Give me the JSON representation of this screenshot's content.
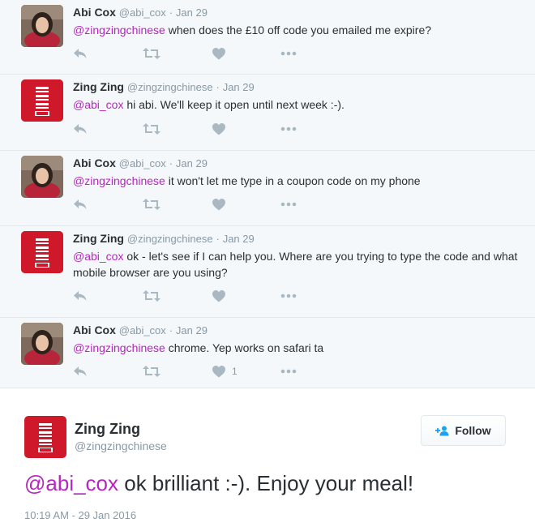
{
  "thread": [
    {
      "fullname": "Abi Cox",
      "handle": "@abi_cox",
      "time": "Jan 29",
      "mention": "@zingzingchinese",
      "text": " when does the £10 off code you emailed me expire?",
      "avatar": "abi-avatar",
      "likes": ""
    },
    {
      "fullname": "Zing Zing",
      "handle": "@zingzingchinese",
      "time": "Jan 29",
      "mention": "@abi_cox",
      "text": " hi abi. We'll keep it open until next week :-).",
      "avatar": "zing-avatar",
      "likes": ""
    },
    {
      "fullname": "Abi Cox",
      "handle": "@abi_cox",
      "time": "Jan 29",
      "mention": "@zingzingchinese",
      "text": " it won't let me type in a coupon code on my phone",
      "avatar": "abi-avatar",
      "likes": ""
    },
    {
      "fullname": "Zing Zing",
      "handle": "@zingzingchinese",
      "time": "Jan 29",
      "mention": "@abi_cox",
      "text": " ok - let's see if I can help you. Where are you trying to type the code and what mobile browser are you using?",
      "avatar": "zing-avatar",
      "likes": ""
    },
    {
      "fullname": "Abi Cox",
      "handle": "@abi_cox",
      "time": "Jan 29",
      "mention": "@zingzingchinese",
      "text": " chrome. Yep works on safari ta",
      "avatar": "abi-avatar",
      "likes": "1"
    }
  ],
  "header_separator": "·",
  "focus": {
    "fullname": "Zing Zing",
    "handle": "@zingzingchinese",
    "follow_label": "Follow",
    "mention": "@abi_cox",
    "text": " ok brilliant :-). Enjoy your meal!",
    "timestamp": "10:19 AM - 29 Jan 2016"
  },
  "icons": {
    "reply": "reply-icon",
    "retweet": "retweet-icon",
    "like": "heart-icon",
    "more": "more-icon",
    "follow": "add-user-icon"
  },
  "colors": {
    "mention": "#b726c0",
    "thread_background": "#f5f8fa",
    "icon": "#aab8c2",
    "secondary_text": "#8899a6",
    "brand_red": "#d0182b"
  }
}
